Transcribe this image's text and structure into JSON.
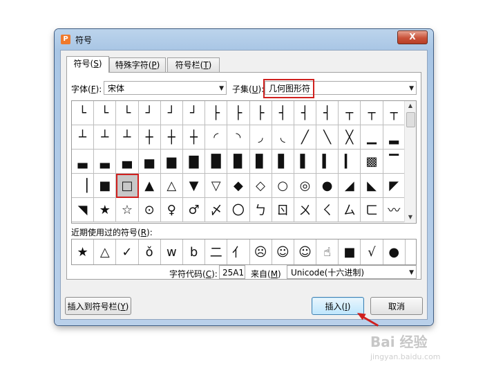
{
  "window": {
    "title": "符号",
    "close_label": "X",
    "app_icon": "P"
  },
  "tabs": [
    {
      "label": "符号(",
      "key": "S",
      "suffix": ")"
    },
    {
      "label": "特殊字符(",
      "key": "P",
      "suffix": ")"
    },
    {
      "label": "符号栏(",
      "key": "T",
      "suffix": ")"
    }
  ],
  "font": {
    "label": "字体(",
    "key": "F",
    "suffix": "):",
    "value": "宋体"
  },
  "subset": {
    "label": "子集(",
    "key": "U",
    "suffix": "):",
    "value": "几何图形符"
  },
  "symbols": [
    "└",
    "└",
    "└",
    "┘",
    "┘",
    "┘",
    "├",
    "├",
    "├",
    "┤",
    "┤",
    "┤",
    "┬",
    "┬",
    "┬",
    "┴",
    "┴",
    "┴",
    "┼",
    "┼",
    "┼",
    "◜",
    "◝",
    "◞",
    "◟",
    "╱",
    "╲",
    "╳",
    "▁",
    "▂",
    "▃",
    "▃",
    "▄",
    "▅",
    "▆",
    "▇",
    "█",
    "▉",
    "▊",
    "▋",
    "▌",
    "▍",
    "▎",
    "▩",
    "▔",
    "▕",
    "■",
    "□",
    "▲",
    "△",
    "▼",
    "▽",
    "◆",
    "◇",
    "○",
    "◎",
    "●",
    "◢",
    "◣",
    "◤",
    "◥",
    "★",
    "☆",
    "⊙",
    "♀",
    "♂",
    "〆",
    "〇",
    "ㄅ",
    "ㄖ",
    "ㄨ",
    "ㄑ",
    "ㄙ",
    "ㄈ",
    "〰"
  ],
  "selected_index": 47,
  "recent": {
    "label": "近期使用过的符号(",
    "key": "R",
    "suffix": "):",
    "items": [
      "★",
      "△",
      "✓",
      "ǒ",
      "w",
      "b",
      "二",
      "亻",
      "☹",
      "☺",
      "☺",
      "☝",
      "■",
      "√",
      "●"
    ]
  },
  "char_code": {
    "label": "字符代码(",
    "key": "C",
    "suffix": "):",
    "value": "25A1"
  },
  "from": {
    "label": "来自(",
    "key": "M",
    "suffix": ")",
    "value": "Unicode(十六进制)"
  },
  "buttons": {
    "insert_to_bar": {
      "label": "插入到符号栏(",
      "key": "Y",
      "suffix": ")"
    },
    "insert": {
      "label": "插入(",
      "key": "I",
      "suffix": ")"
    },
    "cancel": {
      "label": "取消"
    }
  },
  "watermark": {
    "text": "Bai 经验",
    "sub": "jingyan.baidu.com"
  },
  "colors": {
    "highlight": "#d0201e",
    "titlebar": "#b9d0ea",
    "insert_button": "#bee6fd"
  }
}
